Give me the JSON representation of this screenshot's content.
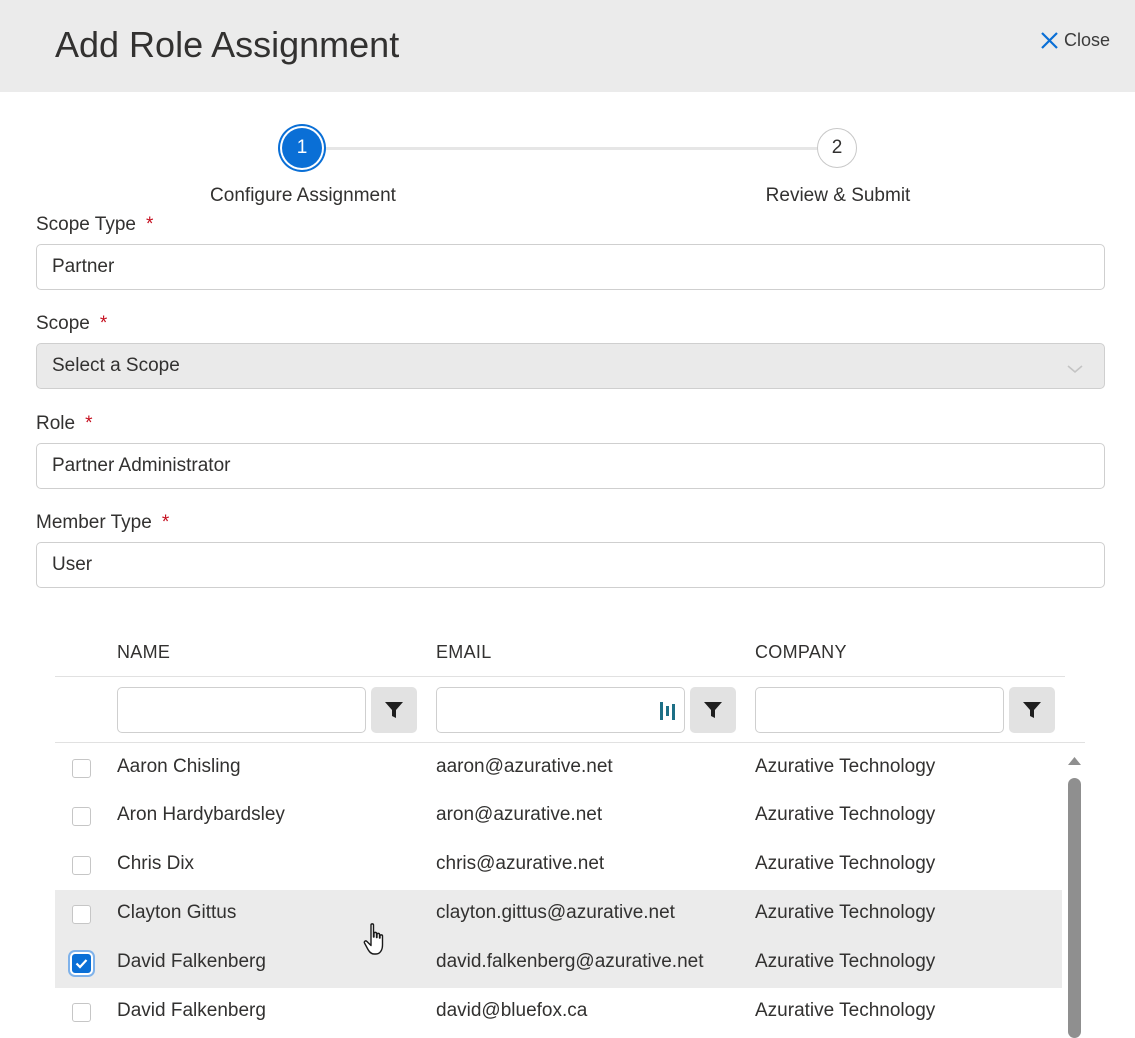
{
  "header": {
    "title": "Add Role Assignment",
    "close_label": "Close"
  },
  "stepper": {
    "steps": [
      {
        "number": "1",
        "label": "Configure Assignment",
        "active": true
      },
      {
        "number": "2",
        "label": "Review & Submit",
        "active": false
      }
    ]
  },
  "form": {
    "required_mark": "*",
    "scope_type": {
      "label": "Scope Type",
      "value": "Partner"
    },
    "scope": {
      "label": "Scope",
      "placeholder": "Select a Scope"
    },
    "role": {
      "label": "Role",
      "value": "Partner Administrator"
    },
    "member_type": {
      "label": "Member Type",
      "value": "User"
    }
  },
  "table": {
    "columns": [
      "NAME",
      "EMAIL",
      "COMPANY"
    ],
    "rows": [
      {
        "name": "Aaron Chisling",
        "email": "aaron@azurative.net",
        "company": "Azurative Technology",
        "checked": false
      },
      {
        "name": "Aron Hardybardsley",
        "email": "aron@azurative.net",
        "company": "Azurative Technology",
        "checked": false
      },
      {
        "name": "Chris Dix",
        "email": "chris@azurative.net",
        "company": "Azurative Technology",
        "checked": false
      },
      {
        "name": "Clayton Gittus",
        "email": "clayton.gittus@azurative.net",
        "company": "Azurative Technology",
        "checked": false
      },
      {
        "name": "David Falkenberg",
        "email": "david.falkenberg@azurative.net",
        "company": "Azurative Technology",
        "checked": true
      },
      {
        "name": "David Falkenberg",
        "email": "david@bluefox.ca",
        "company": "Azurative Technology",
        "checked": false
      }
    ]
  },
  "colors": {
    "accent": "#0a6fd6",
    "required": "#c50f1f",
    "header_bg": "#ebebeb",
    "row_highlight": "#ebebeb"
  },
  "icons": {
    "close": "close-icon",
    "filter": "filter-icon",
    "chevron": "chevron-down-icon",
    "password_manager": "password-manager-icon",
    "checkmark": "checkmark-icon"
  }
}
